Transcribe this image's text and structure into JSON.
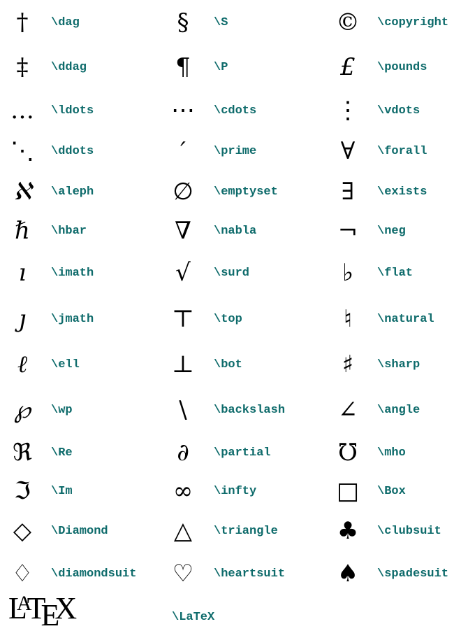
{
  "columns": [
    {
      "rows": [
        {
          "glyph": "†",
          "command": "\\dag"
        },
        {
          "glyph": "‡",
          "command": "\\ddag"
        },
        {
          "glyph": "…",
          "command": "\\ldots"
        },
        {
          "glyph": "⋱",
          "command": "\\ddots"
        },
        {
          "glyph": "ℵ",
          "command": "\\aleph"
        },
        {
          "glyph": "ℏ",
          "command": "\\hbar"
        },
        {
          "glyph": "ı",
          "command": "\\imath"
        },
        {
          "glyph": "ȷ",
          "command": "\\jmath"
        },
        {
          "glyph": "ℓ",
          "command": "\\ell"
        },
        {
          "glyph": "℘",
          "command": "\\wp"
        },
        {
          "glyph": "ℜ",
          "command": "\\Re"
        },
        {
          "glyph": "ℑ",
          "command": "\\Im"
        },
        {
          "glyph": "◇",
          "command": "\\Diamond"
        },
        {
          "glyph": "♢",
          "command": "\\diamondsuit"
        }
      ]
    },
    {
      "rows": [
        {
          "glyph": "§",
          "command": "\\S"
        },
        {
          "glyph": "¶",
          "command": "\\P"
        },
        {
          "glyph": "⋯",
          "command": "\\cdots"
        },
        {
          "glyph": "′",
          "command": "\\prime"
        },
        {
          "glyph": "∅",
          "command": "\\emptyset"
        },
        {
          "glyph": "∇",
          "command": "\\nabla"
        },
        {
          "glyph": "√",
          "command": "\\surd"
        },
        {
          "glyph": "⊤",
          "command": "\\top"
        },
        {
          "glyph": "⊥",
          "command": "\\bot"
        },
        {
          "glyph": "\\",
          "command": "\\backslash"
        },
        {
          "glyph": "∂",
          "command": "\\partial"
        },
        {
          "glyph": "∞",
          "command": "\\infty"
        },
        {
          "glyph": "△",
          "command": "\\triangle"
        },
        {
          "glyph": "♡",
          "command": "\\heartsuit"
        }
      ]
    },
    {
      "rows": [
        {
          "glyph": "©",
          "command": "\\copyright"
        },
        {
          "glyph": "£",
          "command": "\\pounds"
        },
        {
          "glyph": "⋮",
          "command": "\\vdots"
        },
        {
          "glyph": "∀",
          "command": "\\forall"
        },
        {
          "glyph": "∃",
          "command": "\\exists"
        },
        {
          "glyph": "¬",
          "command": "\\neg"
        },
        {
          "glyph": "♭",
          "command": "\\flat"
        },
        {
          "glyph": "♮",
          "command": "\\natural"
        },
        {
          "glyph": "♯",
          "command": "\\sharp"
        },
        {
          "glyph": "∠",
          "command": "\\angle"
        },
        {
          "glyph": "℧",
          "command": "\\mho"
        },
        {
          "glyph": "□",
          "command": "\\Box"
        },
        {
          "glyph": "♣",
          "command": "\\clubsuit"
        },
        {
          "glyph": "♠",
          "command": "\\spadesuit"
        }
      ]
    }
  ],
  "latex_row": {
    "logo": {
      "L": "L",
      "A": "A",
      "T": "T",
      "E": "E",
      "X": "X"
    },
    "command": "\\LaTeX"
  },
  "colors": {
    "command_text": "#0e6b6b",
    "glyph": "#000000"
  }
}
